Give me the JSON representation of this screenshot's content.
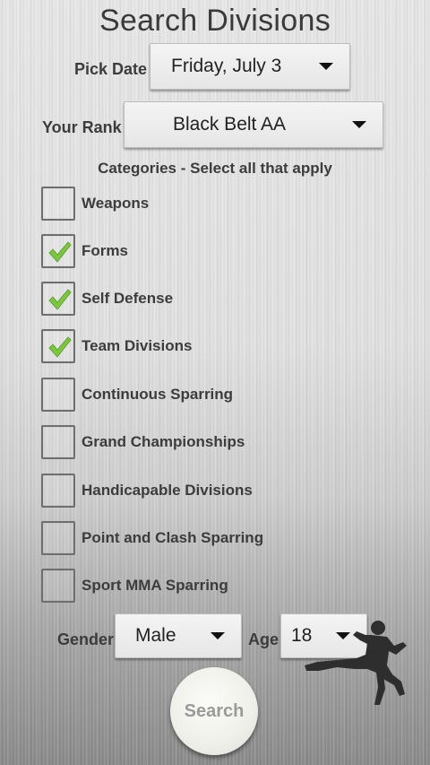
{
  "title": "Search Divisions",
  "pick_date": {
    "label": "Pick Date",
    "value": "Friday, July 3"
  },
  "rank": {
    "label": "Your Rank",
    "value": "Black Belt AA"
  },
  "categories_header": "Categories - Select all that apply",
  "categories": [
    {
      "label": "Weapons",
      "checked": false
    },
    {
      "label": "Forms",
      "checked": true
    },
    {
      "label": "Self Defense",
      "checked": true
    },
    {
      "label": "Team Divisions",
      "checked": true
    },
    {
      "label": "Continuous Sparring",
      "checked": false
    },
    {
      "label": "Grand Championships",
      "checked": false
    },
    {
      "label": "Handicapable Divisions",
      "checked": false
    },
    {
      "label": "Point and Clash Sparring",
      "checked": false
    },
    {
      "label": "Sport MMA Sparring",
      "checked": false
    }
  ],
  "gender": {
    "label": "Gender",
    "value": "Male"
  },
  "age": {
    "label": "Age",
    "value": "18"
  },
  "search_button": "Search",
  "icons": {
    "dropdown": "caret-down-icon",
    "check": "checkmark-icon",
    "karate": "karate-silhouette-icon"
  },
  "colors": {
    "check_green": "#7bc63f"
  }
}
